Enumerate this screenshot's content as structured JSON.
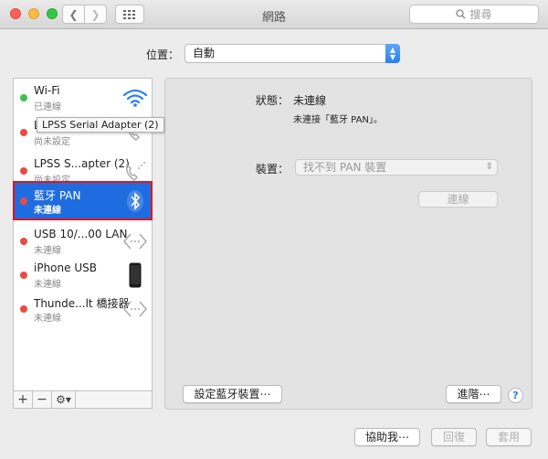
{
  "window": {
    "title": "網路"
  },
  "toolbar": {
    "search_placeholder": "搜尋"
  },
  "location": {
    "label": "位置：",
    "value": "自動"
  },
  "services": [
    {
      "name": "Wi-Fi",
      "status": "已連線",
      "dot_color": "#3cc24a",
      "icon": "wifi-icon"
    },
    {
      "name": "L",
      "status": "尚未設定",
      "dot_color": "#e84b45",
      "icon": "phone-icon"
    },
    {
      "name": "LPSS S...apter (2)",
      "status": "尚未設定",
      "dot_color": "#e84b45",
      "icon": "phone-icon"
    },
    {
      "name": "藍牙 PAN",
      "status": "未連線",
      "dot_color": "#e84b45",
      "icon": "bluetooth-icon"
    },
    {
      "name": "USB 10/...00 LAN",
      "status": "未連線",
      "dot_color": "#e84b45",
      "icon": "ethernet-icon"
    },
    {
      "name": "iPhone USB",
      "status": "未連線",
      "dot_color": "#e84b45",
      "icon": "iphone-icon"
    },
    {
      "name": "Thunde...lt 橋接器",
      "status": "未連線",
      "dot_color": "#e84b45",
      "icon": "ethernet-icon"
    }
  ],
  "tooltip": "LPSS Serial Adapter (2)",
  "sidebar_toolbar": {
    "add": "+",
    "remove": "−",
    "gear": "⚙▾"
  },
  "detail": {
    "status_label": "狀態：",
    "status_value": "未連線",
    "status_desc": "未連接「藍牙 PAN」。",
    "device_label": "裝置：",
    "device_value": "找不到 PAN 裝置",
    "connect_button": "連線",
    "setup_button": "設定藍牙裝置⋯",
    "advanced_button": "進階⋯"
  },
  "footer": {
    "assist": "協助我⋯",
    "revert": "回復",
    "apply": "套用"
  }
}
